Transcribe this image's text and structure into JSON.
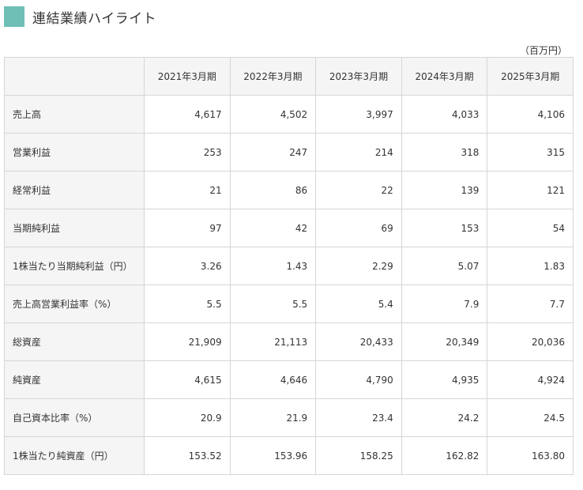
{
  "section": {
    "title": "連結業績ハイライト",
    "accent_color": "#6fbfb7"
  },
  "unit": "（百万円）",
  "table": {
    "columns": [
      "2021年3月期",
      "2022年3月期",
      "2023年3月期",
      "2024年3月期",
      "2025年3月期"
    ],
    "rows": [
      {
        "label": "売上高",
        "values": [
          "4,617",
          "4,502",
          "3,997",
          "4,033",
          "4,106"
        ]
      },
      {
        "label": "営業利益",
        "values": [
          "253",
          "247",
          "214",
          "318",
          "315"
        ]
      },
      {
        "label": "経常利益",
        "values": [
          "21",
          "86",
          "22",
          "139",
          "121"
        ]
      },
      {
        "label": "当期純利益",
        "values": [
          "97",
          "42",
          "69",
          "153",
          "54"
        ]
      },
      {
        "label": "1株当たり当期純利益（円）",
        "values": [
          "3.26",
          "1.43",
          "2.29",
          "5.07",
          "1.83"
        ]
      },
      {
        "label": "売上高営業利益率（%）",
        "values": [
          "5.5",
          "5.5",
          "5.4",
          "7.9",
          "7.7"
        ]
      },
      {
        "label": "総資産",
        "values": [
          "21,909",
          "21,113",
          "20,433",
          "20,349",
          "20,036"
        ]
      },
      {
        "label": "純資産",
        "values": [
          "4,615",
          "4,646",
          "4,790",
          "4,935",
          "4,924"
        ]
      },
      {
        "label": "自己資本比率（%）",
        "values": [
          "20.9",
          "21.9",
          "23.4",
          "24.2",
          "24.5"
        ]
      },
      {
        "label": "1株当たり純資産（円）",
        "values": [
          "153.52",
          "153.96",
          "158.25",
          "162.82",
          "163.80"
        ]
      }
    ]
  }
}
